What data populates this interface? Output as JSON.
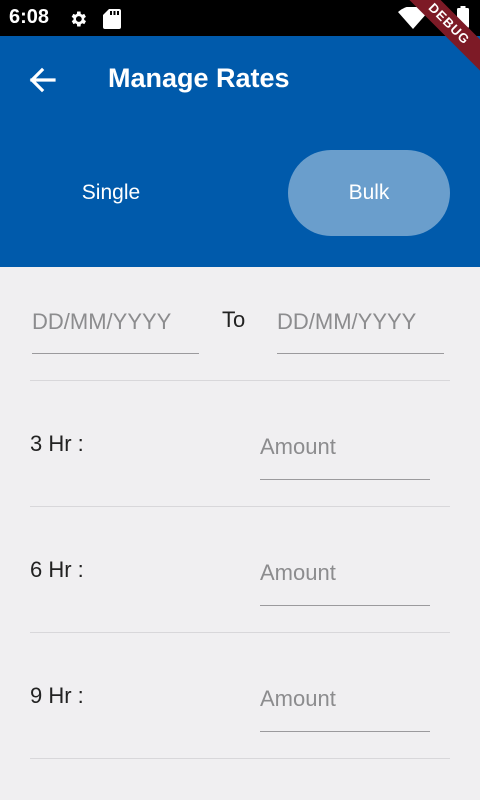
{
  "status": {
    "time": "6:08"
  },
  "debug_label": "DEBUG",
  "header": {
    "title": "Manage Rates"
  },
  "segments": [
    {
      "label": "Single",
      "selected": false
    },
    {
      "label": "Bulk",
      "selected": true
    }
  ],
  "date_range": {
    "from_placeholder": "DD/MM/YYYY",
    "separator": "To",
    "to_placeholder": "DD/MM/YYYY"
  },
  "rates": [
    {
      "label": "3 Hr :",
      "placeholder": "Amount"
    },
    {
      "label": "6 Hr :",
      "placeholder": "Amount"
    },
    {
      "label": "9 Hr :",
      "placeholder": "Amount"
    }
  ],
  "colors": {
    "primary": "#005aab",
    "selected_segment": "#6a9ecc",
    "background": "#f0eff1"
  }
}
